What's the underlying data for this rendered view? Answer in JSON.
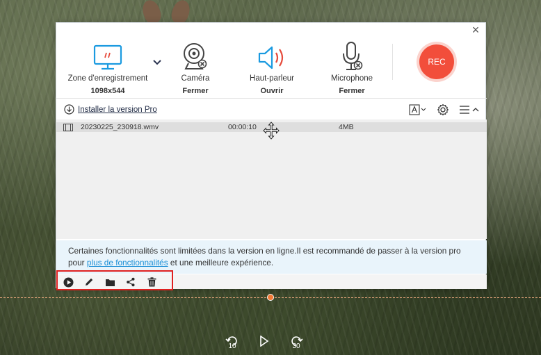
{
  "dialog": {
    "close_label": "×",
    "tools": [
      {
        "id": "zone",
        "label": "Zone d'enregistrement",
        "value": "1098x544",
        "icon": "monitor-icon"
      },
      {
        "id": "camera",
        "label": "Caméra",
        "value": "Fermer",
        "icon": "webcam-off-icon"
      },
      {
        "id": "speaker",
        "label": "Haut-parleur",
        "value": "Ouvrir",
        "icon": "speaker-icon"
      },
      {
        "id": "mic",
        "label": "Microphone",
        "value": "Fermer",
        "icon": "microphone-off-icon"
      }
    ],
    "rec_label": "REC",
    "install_label": "Installer la version Pro",
    "file": {
      "name": "20230225_230918.wmv",
      "duration": "00:00:10",
      "size": "4MB"
    },
    "notice": {
      "text_before": "Certaines fonctionnalités sont limitées dans la version en ligne.Il est recommandé de passer à la version pro pour ",
      "link": "plus de fonctionnalités",
      "text_after": " et une meilleure expérience."
    }
  },
  "player": {
    "rewind_label": "10",
    "forward_label": "30"
  },
  "colors": {
    "accent_blue": "#1a8ed6",
    "rec_red": "#f24e3b",
    "highlight_red": "#e0201f"
  }
}
